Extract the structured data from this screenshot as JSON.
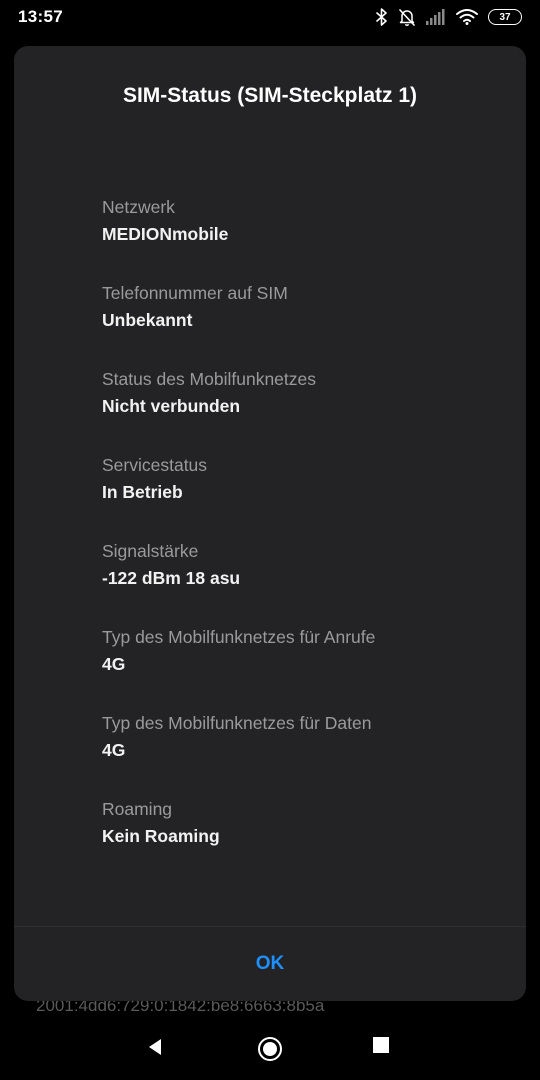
{
  "status_bar": {
    "time": "13:57",
    "battery": "37",
    "icons": [
      "bluetooth-icon",
      "notifications-off-icon",
      "signal-icon",
      "wifi-icon",
      "battery-icon"
    ]
  },
  "background": {
    "ip_address": "2001:4dd6:729:0:1842:be8:6663:8b5a"
  },
  "dialog": {
    "title": "SIM-Status (SIM-Steckplatz 1)",
    "items": [
      {
        "label": "Netzwerk",
        "value": "MEDIONmobile"
      },
      {
        "label": "Telefonnummer auf SIM",
        "value": "Unbekannt"
      },
      {
        "label": "Status des Mobilfunknetzes",
        "value": "Nicht verbunden"
      },
      {
        "label": "Servicestatus",
        "value": "In Betrieb"
      },
      {
        "label": "Signalstärke",
        "value": "-122 dBm 18 asu"
      },
      {
        "label": "Typ des Mobilfunknetzes für Anrufe",
        "value": "4G"
      },
      {
        "label": "Typ des Mobilfunknetzes für Daten",
        "value": "4G"
      },
      {
        "label": "Roaming",
        "value": "Kein Roaming"
      }
    ],
    "ok_label": "OK"
  },
  "nav": {
    "icons": [
      "back-icon",
      "home-icon",
      "recents-icon"
    ]
  },
  "colors": {
    "accent": "#1e90ff",
    "dialog_bg": "#232325",
    "label": "#9a9a9c"
  }
}
